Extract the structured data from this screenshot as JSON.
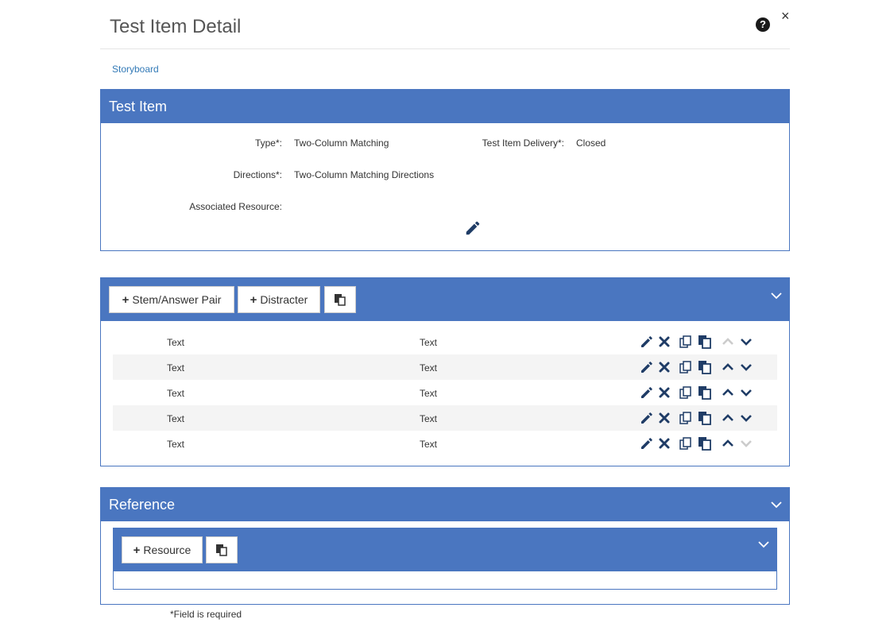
{
  "modal": {
    "title": "Test Item Detail",
    "help_glyph": "?",
    "close_glyph": "×"
  },
  "breadcrumb": {
    "label": "Storyboard"
  },
  "test_item": {
    "title": "Test Item",
    "type_label": "Type*:",
    "type_value": "Two-Column Matching",
    "delivery_label": "Test Item Delivery*:",
    "delivery_value": "Closed",
    "directions_label": "Directions*:",
    "directions_value": "Two-Column Matching Directions",
    "resource_label": "Associated Resource:"
  },
  "pairs": {
    "add_pair_label": "Stem/Answer Pair",
    "add_distracter_label": "Distracter",
    "rows": [
      {
        "stem": "Text",
        "answer": "Text",
        "can_move_up": false,
        "can_move_down": true
      },
      {
        "stem": "Text",
        "answer": "Text",
        "can_move_up": true,
        "can_move_down": true
      },
      {
        "stem": "Text",
        "answer": "Text",
        "can_move_up": true,
        "can_move_down": true
      },
      {
        "stem": "Text",
        "answer": "Text",
        "can_move_up": true,
        "can_move_down": true
      },
      {
        "stem": "Text",
        "answer": "Text",
        "can_move_up": true,
        "can_move_down": false
      }
    ]
  },
  "reference": {
    "title": "Reference",
    "add_resource_label": "Resource"
  },
  "footnote": "*Field is required",
  "colors": {
    "panel_header": "#4a76c0",
    "icon": "#1f3c66",
    "icon_disabled": "#cccccc",
    "link": "#337ab7",
    "row_alt": "#f4f4f4"
  },
  "icons": [
    "help-icon",
    "close-icon",
    "pencil-icon",
    "delete-icon",
    "copy-icon",
    "paste-icon",
    "chevron-up-icon",
    "chevron-down-icon",
    "plus-icon"
  ]
}
